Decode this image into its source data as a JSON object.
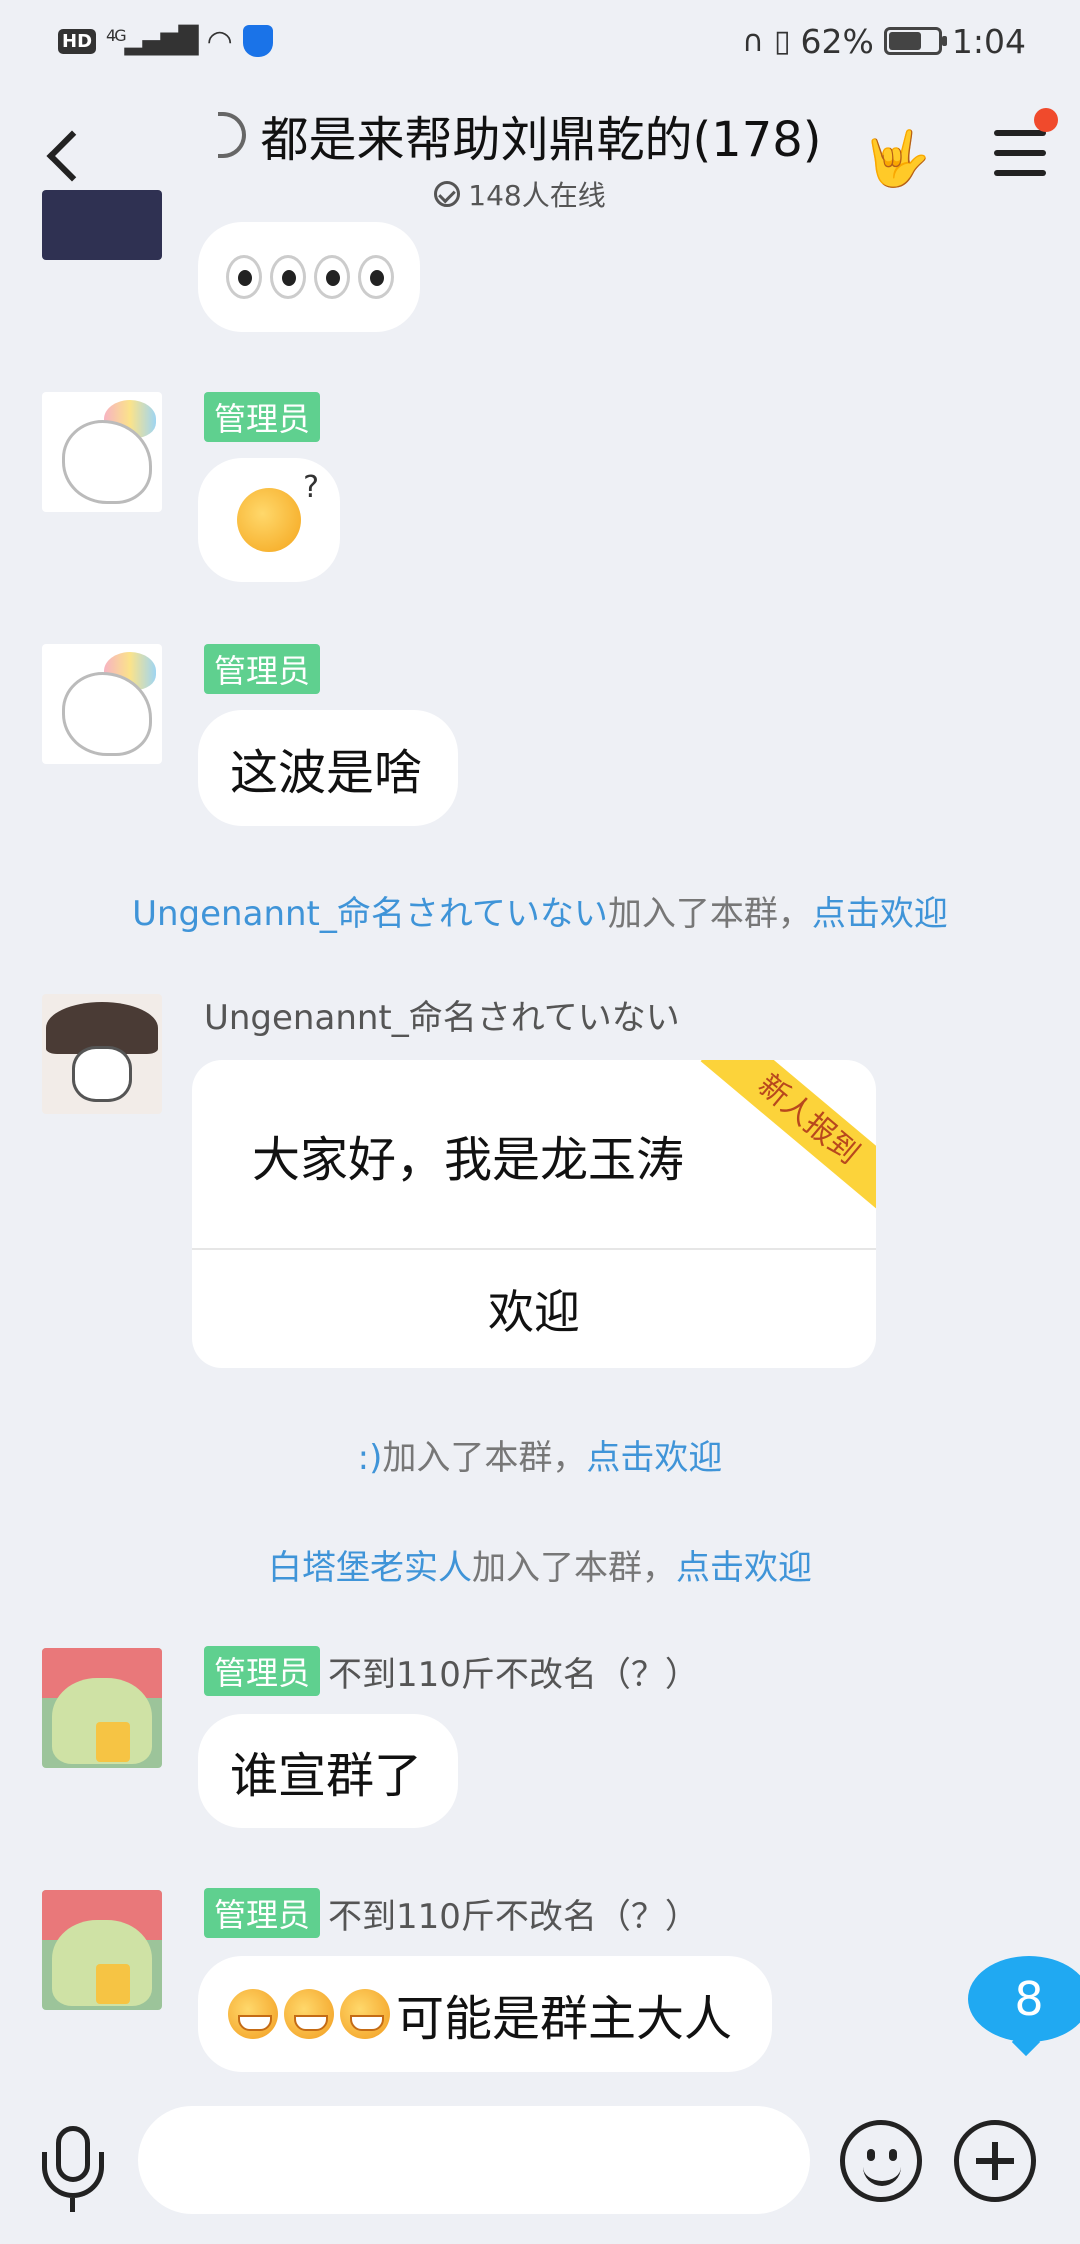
{
  "status_bar": {
    "left_hd": "HD",
    "left_network": "4G",
    "battery_percent": "62%",
    "battery_level": 0.62,
    "time": "1:04"
  },
  "header": {
    "title": "都是来帮助刘鼎乾的(178)",
    "online_text": "148人在线",
    "has_notification": true
  },
  "messages": {
    "m1": {
      "type": "emoji",
      "emoji": "eyes-x4"
    },
    "m2": {
      "admin_badge": "管理员",
      "emoji": "confused-face"
    },
    "m3": {
      "admin_badge": "管理员",
      "text": "这波是啥"
    },
    "sys1": {
      "name": "Ungenannt_命名されていない",
      "action": "加入了本群，",
      "link": "点击欢迎"
    },
    "m4": {
      "nickname": "Ungenannt_命名されていない",
      "card_text": "大家好，我是龙玉涛",
      "ribbon": "新人报到",
      "welcome_button": "欢迎"
    },
    "sys2": {
      "name": ":)",
      "action": "加入了本群，",
      "link": "点击欢迎"
    },
    "sys3": {
      "name": "白塔堡老实人",
      "action": "加入了本群，",
      "link": "点击欢迎"
    },
    "m5": {
      "admin_badge": "管理员",
      "nickname": "不到110斤不改名（？）",
      "text": "谁宣群了"
    },
    "m6": {
      "admin_badge": "管理员",
      "nickname": "不到110斤不改名（？）",
      "text": "可能是群主大人"
    }
  },
  "unread_count": "8",
  "input": {
    "placeholder": ""
  },
  "colors": {
    "accent_link": "#3f94d8",
    "admin_badge": "#5fd08f",
    "unread_bubble": "#20a9f2",
    "notification_dot": "#f04a2c",
    "ribbon": "#fcd33a"
  }
}
